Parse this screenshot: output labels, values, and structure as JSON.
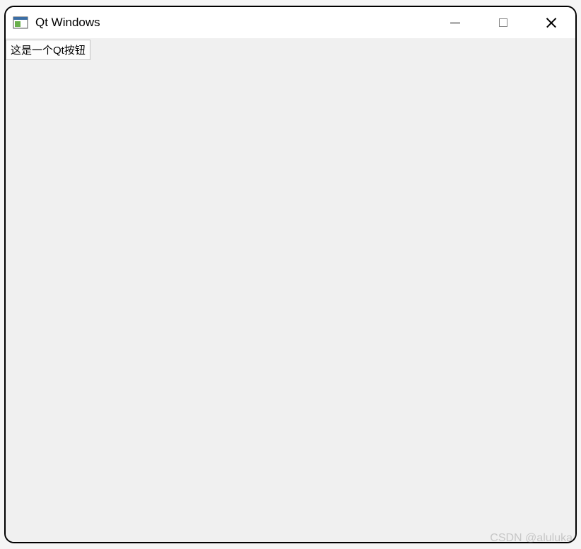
{
  "window": {
    "title": "Qt Windows"
  },
  "client": {
    "button_label": "这是一个Qt按钮"
  },
  "watermark": "CSDN @aluluka"
}
